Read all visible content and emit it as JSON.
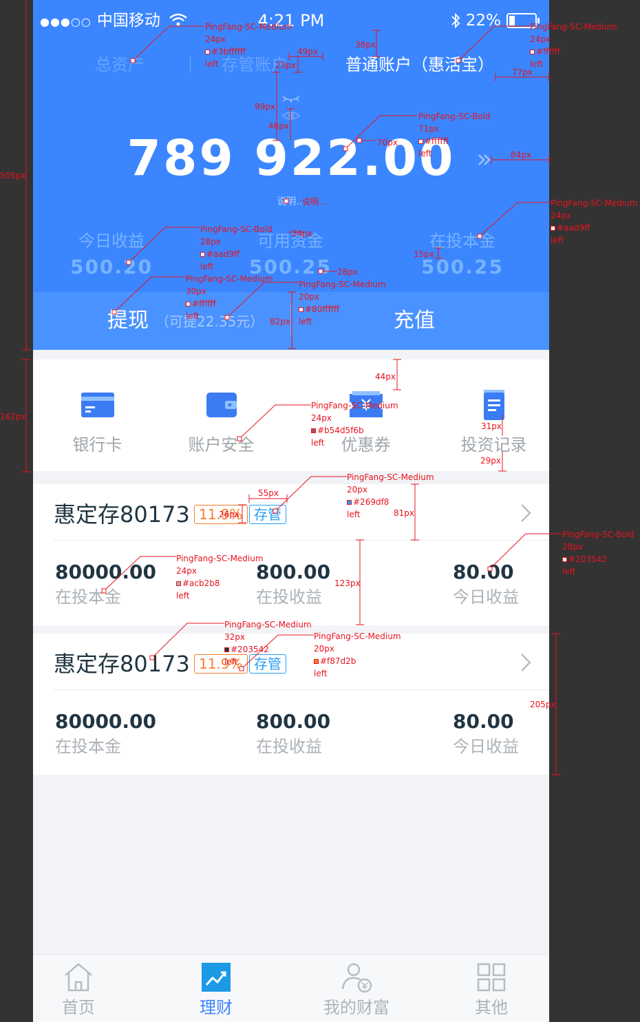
{
  "status": {
    "carrier": "中国移动",
    "time": "4:21 PM",
    "battery": "22%"
  },
  "tabs": {
    "total": "总资产",
    "custody": "存管账户",
    "normal": "普通账户（惠活宝）"
  },
  "summary": {
    "amount": "789 922.00",
    "explain": "说明..."
  },
  "stats": [
    {
      "label": "今日收益",
      "value": "500.20"
    },
    {
      "label": "可用资金",
      "value": "500.25"
    },
    {
      "label": "在投本金",
      "value": "500.25"
    }
  ],
  "actions": {
    "withdraw": "提现",
    "withdraw_note": "（可提22.35元）",
    "recharge": "充值"
  },
  "quick_menu": [
    {
      "label": "银行卡",
      "icon": "bank-card-icon"
    },
    {
      "label": "账户安全",
      "icon": "wallet-icon"
    },
    {
      "label": "优惠券",
      "icon": "coupon-icon"
    },
    {
      "label": "投资记录",
      "icon": "document-icon"
    }
  ],
  "products": [
    {
      "title": "惠定存80173",
      "rate": "11.9%",
      "tag": "存管",
      "cols": [
        {
          "value": "80000.00",
          "label": "在投本金"
        },
        {
          "value": "800.00",
          "label": "在投收益"
        },
        {
          "value": "80.00",
          "label": "今日收益"
        }
      ]
    },
    {
      "title": "惠定存80173",
      "rate": "11.9%",
      "tag": "存管",
      "cols": [
        {
          "value": "80000.00",
          "label": "在投本金"
        },
        {
          "value": "800.00",
          "label": "在投收益"
        },
        {
          "value": "80.00",
          "label": "今日收益"
        }
      ]
    }
  ],
  "nav": [
    {
      "label": "首页",
      "icon": "home-icon"
    },
    {
      "label": "理财",
      "icon": "chart-icon"
    },
    {
      "label": "我的财富",
      "icon": "user-yuan-icon"
    },
    {
      "label": "其他",
      "icon": "grid-icon"
    }
  ],
  "colors": {
    "brand": "#3b86ff",
    "header_bottom": "#4a92ff",
    "text_dark": "#203542",
    "text_muted": "#acb2b8",
    "stat_text": "#aad9ff",
    "rate_orange": "#f87d2b",
    "tag_blue": "#269df8",
    "annotation_red": "#e8131f"
  },
  "annotations": {
    "spec_a": {
      "font": "PingFang-SC-Medium",
      "size": "24px",
      "color": "#3bffffff",
      "align": "left"
    },
    "spec_b": {
      "font": "PingFang-SC-Medium",
      "size": "24px",
      "color": "#ffffff",
      "align": "left"
    },
    "spec_c": {
      "font": "PingFang-SC-Bold",
      "size": "71px",
      "color": "#ffffff",
      "align": "left"
    },
    "spec_d": {
      "font": "PingFang-SC-Medium",
      "size": "24px",
      "color": "#aad9ff",
      "align": "left"
    },
    "spec_e": {
      "font": "PingFang-SC-Bold",
      "size": "28px",
      "color": "#aad9ff",
      "align": "left"
    },
    "spec_f": {
      "font": "PingFang-SC-Medium",
      "size": "30px",
      "color": "#ffffff",
      "align": "left"
    },
    "spec_g": {
      "font": "PingFang-SC-Medium",
      "size": "20px",
      "color": "#80ffffff",
      "align": "left"
    },
    "spec_h": {
      "font": "PingFang-SC-Medium",
      "size": "24px",
      "color": "#b54d5f6b",
      "align": "left"
    },
    "spec_i": {
      "font": "PingFang-SC-Medium",
      "size": "20px",
      "color": "#269df8",
      "align": "left"
    },
    "spec_j": {
      "font": "PingFang-SC-Bold",
      "size": "28px",
      "color": "#203542",
      "align": "left"
    },
    "spec_k": {
      "font": "PingFang-SC-Medium",
      "size": "24px",
      "color": "#acb2b8",
      "align": "left"
    },
    "spec_l": {
      "font": "PingFang-SC-Medium",
      "size": "32px",
      "color": "#203542",
      "align": "left"
    },
    "spec_m": {
      "font": "PingFang-SC-Medium",
      "size": "20px",
      "color": "#f87d2b",
      "align": "left"
    },
    "dims": {
      "d38": "38px",
      "d49": "49px",
      "d23": "23px",
      "d77": "77px",
      "d99": "99px",
      "d46": "46px",
      "d70": "70px",
      "d84": "84px",
      "d24": "24px",
      "d15": "15px",
      "d28": "28px",
      "d82": "82px",
      "d505": "505px",
      "d162": "162px",
      "d44": "44px",
      "d31": "31px",
      "d29": "29px",
      "d55": "55px",
      "d26": "26px",
      "d81": "81px",
      "d123": "123px",
      "d205": "205px"
    }
  }
}
